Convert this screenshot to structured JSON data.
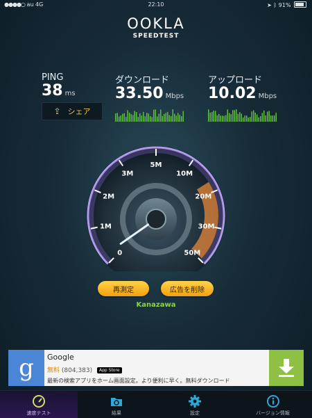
{
  "status_bar": {
    "carrier": "au",
    "network": "4G",
    "time": "22:10",
    "battery": "91%"
  },
  "logo": {
    "main": "OOKLA",
    "sub": "SPEEDTEST"
  },
  "ping": {
    "label": "PING",
    "value": "38",
    "unit": "ms"
  },
  "download": {
    "label": "ダウンロード",
    "value": "33.50",
    "unit": "Mbps"
  },
  "upload": {
    "label": "アップロード",
    "value": "10.02",
    "unit": "Mbps"
  },
  "share": {
    "label": "シェア",
    "icon": "share-icon"
  },
  "gauge": {
    "ticks": [
      "0",
      "1M",
      "2M",
      "3M",
      "5M",
      "10M",
      "20M",
      "30M",
      "50M"
    ],
    "needle_value_mbps": 0.3
  },
  "buttons": {
    "retest": "再測定",
    "remove_ads": "広告を削除"
  },
  "server": "Kanazawa",
  "ad": {
    "logo_letter": "g",
    "title": "Google",
    "price": "無料",
    "count": "(804,383)",
    "store": "App Store",
    "description": "最新の検索アプリをホーム画面設定。より便利に早く。無料ダウンロード"
  },
  "tabs": [
    {
      "label": "速度テスト",
      "icon": "speedometer-icon"
    },
    {
      "label": "結果",
      "icon": "folder-icon"
    },
    {
      "label": "設定",
      "icon": "gear-icon"
    },
    {
      "label": "バージョン情報",
      "icon": "info-icon"
    }
  ],
  "colors": {
    "accent": "#f3c341",
    "download_bars": "#5fbf3a",
    "server": "#8fd14f",
    "ad_download": "#8ec043",
    "gauge_ring": "#9b7fd6"
  }
}
